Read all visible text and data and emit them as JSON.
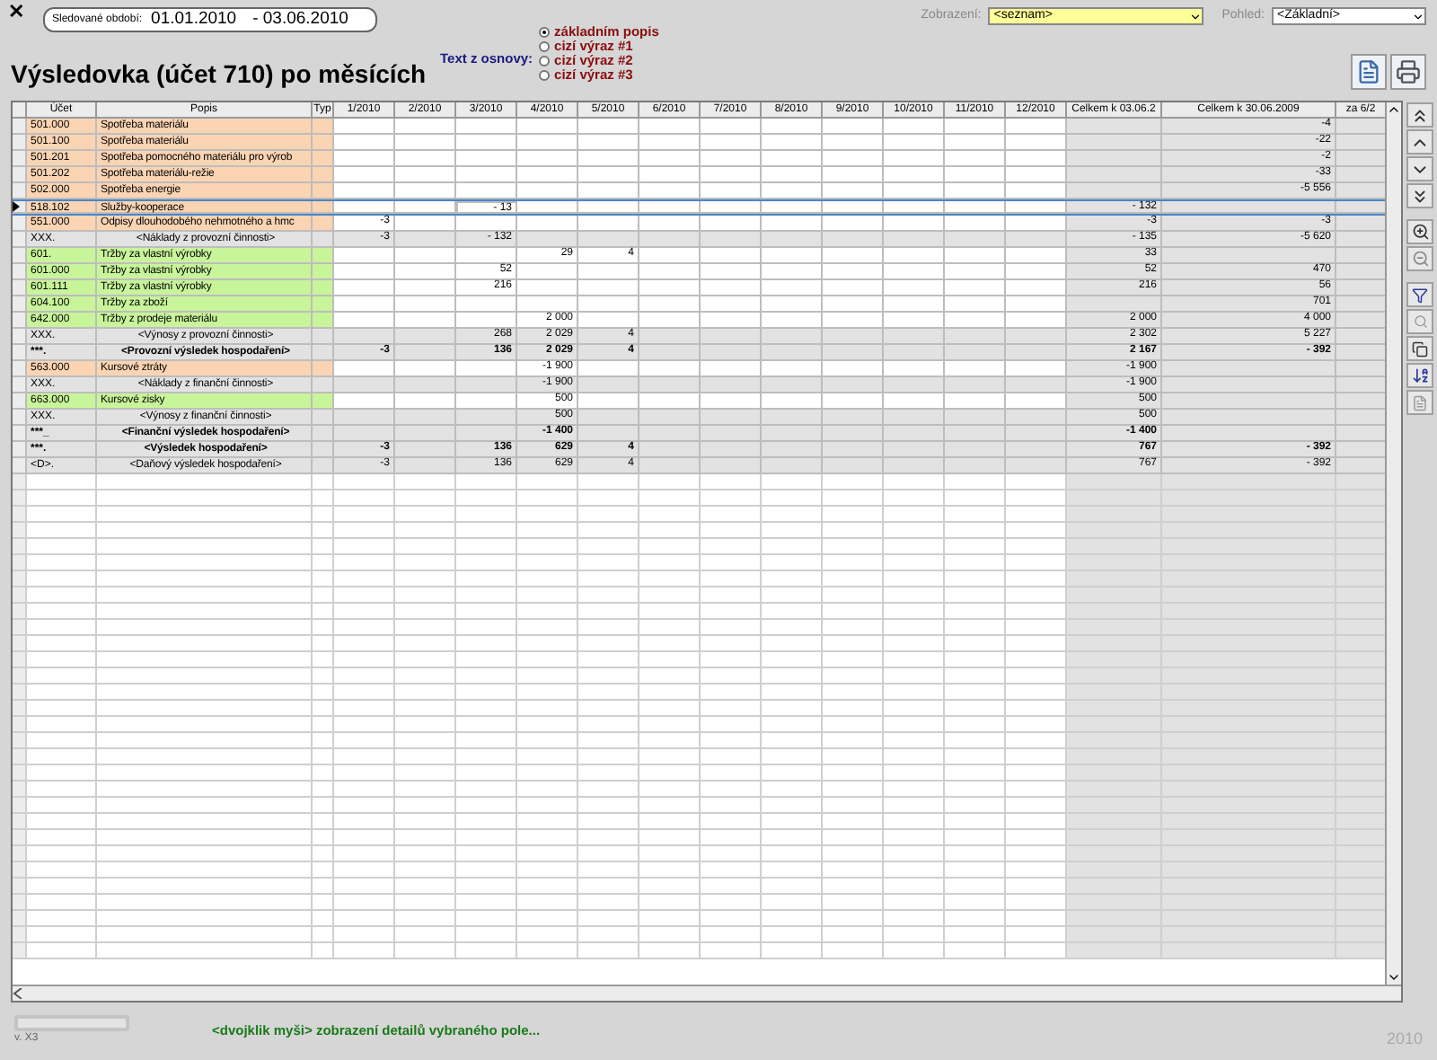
{
  "close_button": {
    "label": "✕"
  },
  "period": {
    "label": "Sledované období:",
    "from": "01.01.2010",
    "to": "- 03.06.2010"
  },
  "title": "Výsledovka (účet 710) po měsících",
  "text_source": {
    "label": "Text z osnovy:",
    "options": [
      {
        "label": "základním popis",
        "selected": true
      },
      {
        "label": "cizí výraz #1",
        "selected": false
      },
      {
        "label": "cizí výraz #2",
        "selected": false
      },
      {
        "label": "cizí výraz #3",
        "selected": false
      }
    ]
  },
  "display": {
    "label": "Zobrazení:",
    "value": "<seznam>"
  },
  "view": {
    "label": "Pohled:",
    "value": "<Základní>"
  },
  "table": {
    "columns": [
      "Účet",
      "Popis",
      "Typ",
      "1/2010",
      "2/2010",
      "3/2010",
      "4/2010",
      "5/2010",
      "6/2010",
      "7/2010",
      "8/2010",
      "9/2010",
      "10/2010",
      "11/2010",
      "12/2010",
      "Celkem k 03.06.2",
      "Celkem k 30.06.2009",
      "za 6/2"
    ],
    "rows": [
      {
        "account": "501.000",
        "description": "Spotřeba materiálu",
        "kind": "cost",
        "selected": false,
        "values": {
          "total_2009": "-4"
        }
      },
      {
        "account": "501.100",
        "description": "Spotřeba materiálu",
        "kind": "cost",
        "selected": false,
        "values": {
          "total_2009": "-22"
        }
      },
      {
        "account": "501.201",
        "description": "Spotřeba pomocného materiálu pro výrob",
        "kind": "cost",
        "selected": false,
        "values": {
          "total_2009": "-2"
        }
      },
      {
        "account": "501.202",
        "description": "Spotřeba materiálu-režie",
        "kind": "cost",
        "selected": false,
        "values": {
          "total_2009": "-33"
        }
      },
      {
        "account": "502.000",
        "description": "Spotřeba energie",
        "kind": "cost",
        "selected": false,
        "values": {
          "total_2009": "-5 556"
        }
      },
      {
        "account": "518.102",
        "description": "Služby-kooperace",
        "kind": "cost",
        "selected": true,
        "values": {
          "m3": "- 13",
          "total_to_date": "- 132"
        }
      },
      {
        "account": "551.000",
        "description": "Odpisy dlouhodobého nehmotného a hmc",
        "kind": "cost",
        "selected": false,
        "values": {
          "m1": "-3",
          "total_to_date": "-3",
          "total_2009": "-3"
        }
      },
      {
        "account": "XXX.",
        "description": "<Náklady z provozní činnosti>",
        "kind": "subtotal",
        "selected": false,
        "values": {
          "m1": "-3",
          "m3": "- 132",
          "total_to_date": "- 135",
          "total_2009": "-5 620"
        }
      },
      {
        "account": "601.",
        "description": "Tržby za vlastní výrobky",
        "kind": "revenue",
        "selected": false,
        "values": {
          "m4": "29",
          "m5": "4",
          "total_to_date": "33"
        }
      },
      {
        "account": "601.000",
        "description": "Tržby za vlastní výrobky",
        "kind": "revenue",
        "selected": false,
        "values": {
          "m3": "52",
          "total_to_date": "52",
          "total_2009": "470"
        }
      },
      {
        "account": "601.111",
        "description": "Tržby za vlastní výrobky",
        "kind": "revenue",
        "selected": false,
        "values": {
          "m3": "216",
          "total_to_date": "216",
          "total_2009": "56"
        }
      },
      {
        "account": "604.100",
        "description": "Tržby za zboží",
        "kind": "revenue",
        "selected": false,
        "values": {
          "total_2009": "701"
        }
      },
      {
        "account": "642.000",
        "description": "Tržby z prodeje materiálu",
        "kind": "revenue",
        "selected": false,
        "values": {
          "m4": "2 000",
          "total_to_date": "2 000",
          "total_2009": "4 000"
        }
      },
      {
        "account": "XXX.",
        "description": "<Výnosy z provozní činnosti>",
        "kind": "subtotal",
        "selected": false,
        "values": {
          "m3": "268",
          "m4": "2 029",
          "m5": "4",
          "total_to_date": "2 302",
          "total_2009": "5 227"
        }
      },
      {
        "account": "***.",
        "description": "<Provozní výsledek hospodaření>",
        "kind": "total",
        "selected": false,
        "values": {
          "m1": "-3",
          "m3": "136",
          "m4": "2 029",
          "m5": "4",
          "total_to_date": "2 167",
          "total_2009": "- 392"
        }
      },
      {
        "account": "563.000",
        "description": "Kursové ztráty",
        "kind": "cost",
        "selected": false,
        "values": {
          "m4": "-1 900",
          "total_to_date": "-1 900"
        }
      },
      {
        "account": "XXX.",
        "description": "<Náklady z finanční činnosti>",
        "kind": "subtotal",
        "selected": false,
        "values": {
          "m4": "-1 900",
          "total_to_date": "-1 900"
        }
      },
      {
        "account": "663.000",
        "description": "Kursové zisky",
        "kind": "revenue",
        "selected": false,
        "values": {
          "m4": "500",
          "total_to_date": "500"
        }
      },
      {
        "account": "XXX.",
        "description": "<Výnosy z finanční činnosti>",
        "kind": "subtotal",
        "selected": false,
        "values": {
          "m4": "500",
          "total_to_date": "500"
        }
      },
      {
        "account": "***_",
        "description": "<Finanční výsledek hospodaření>",
        "kind": "total",
        "selected": false,
        "values": {
          "m4": "-1 400",
          "total_to_date": "-1 400"
        }
      },
      {
        "account": "***.",
        "description": "<Výsledek hospodaření>",
        "kind": "total",
        "selected": false,
        "values": {
          "m1": "-3",
          "m3": "136",
          "m4": "629",
          "m5": "4",
          "total_to_date": "767",
          "total_2009": "- 392"
        }
      },
      {
        "account": "<D>.",
        "description": "<Daňový výsledek hospodaření>",
        "kind": "subtotal",
        "selected": false,
        "values": {
          "m1": "-3",
          "m3": "136",
          "m4": "629",
          "m5": "4",
          "total_to_date": "767",
          "total_2009": "- 392"
        }
      }
    ]
  },
  "status_message": "<dvojklik myši> zobrazení detailů vybraného pole...",
  "logo": {
    "version": "v. X3"
  },
  "year": "2010"
}
